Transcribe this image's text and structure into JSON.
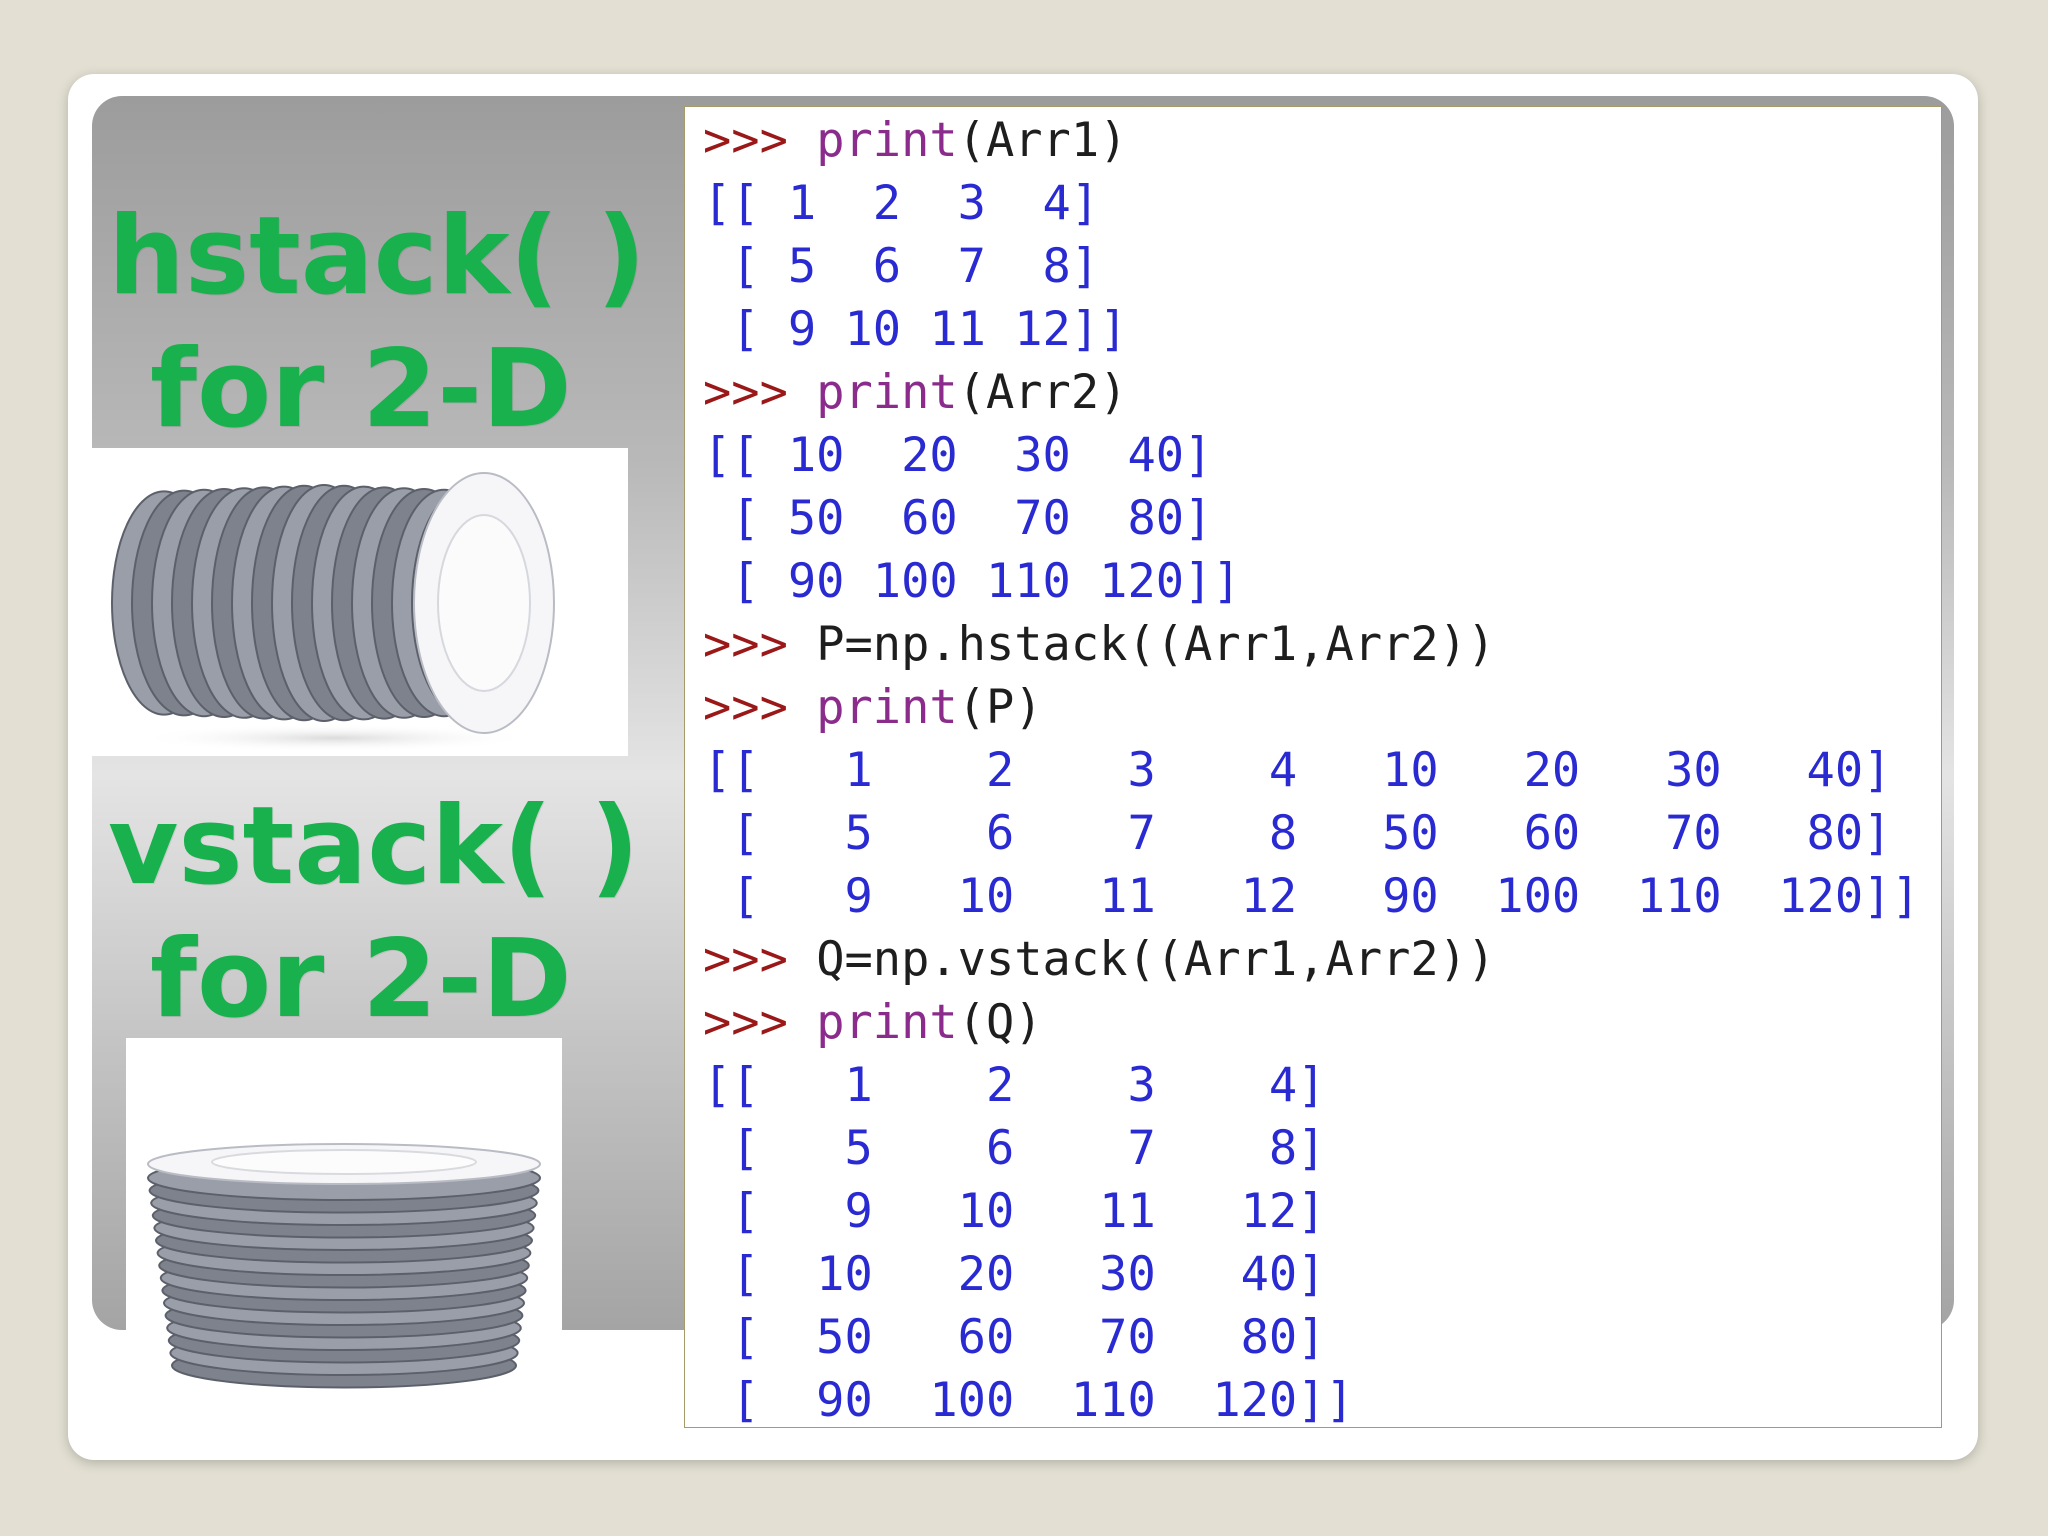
{
  "slide": {
    "headings": [
      "hstack( )",
      "for 2-D",
      "vstack( )",
      "for 2-D"
    ],
    "images": {
      "horizontal": "plates-stacked-horizontally",
      "vertical": "plates-stacked-vertically"
    }
  },
  "console": {
    "lines": [
      {
        "type": "input",
        "prompt": ">>> ",
        "keyword": "print",
        "code": "(Arr1)"
      },
      {
        "type": "output",
        "text": "[[ 1  2  3  4]"
      },
      {
        "type": "output",
        "text": " [ 5  6  7  8]"
      },
      {
        "type": "output",
        "text": " [ 9 10 11 12]]"
      },
      {
        "type": "input",
        "prompt": ">>> ",
        "keyword": "print",
        "code": "(Arr2)"
      },
      {
        "type": "output",
        "text": "[[ 10  20  30  40]"
      },
      {
        "type": "output",
        "text": " [ 50  60  70  80]"
      },
      {
        "type": "output",
        "text": " [ 90 100 110 120]]"
      },
      {
        "type": "input",
        "prompt": ">>> ",
        "keyword": "",
        "code": "P=np.hstack((Arr1,Arr2))"
      },
      {
        "type": "input",
        "prompt": ">>> ",
        "keyword": "print",
        "code": "(P)"
      },
      {
        "type": "output",
        "text": "[[   1    2    3    4   10   20   30   40]"
      },
      {
        "type": "output",
        "text": " [   5    6    7    8   50   60   70   80]"
      },
      {
        "type": "output",
        "text": " [   9   10   11   12   90  100  110  120]]"
      },
      {
        "type": "input",
        "prompt": ">>> ",
        "keyword": "",
        "code": "Q=np.vstack((Arr1,Arr2))"
      },
      {
        "type": "input",
        "prompt": ">>> ",
        "keyword": "print",
        "code": "(Q)"
      },
      {
        "type": "output",
        "text": "[[   1    2    3    4]"
      },
      {
        "type": "output",
        "text": " [   5    6    7    8]"
      },
      {
        "type": "output",
        "text": " [   9   10   11   12]"
      },
      {
        "type": "output",
        "text": " [  10   20   30   40]"
      },
      {
        "type": "output",
        "text": " [  50   60   70   80]"
      },
      {
        "type": "output",
        "text": " [  90  100  110  120]]"
      }
    ]
  },
  "colors": {
    "background": "#e3e0d3",
    "heading": "#19b14d",
    "prompt": "#9b1818",
    "keyword": "#8b2c8c",
    "code": "#1e1e1e",
    "output": "#2a2ad2"
  }
}
